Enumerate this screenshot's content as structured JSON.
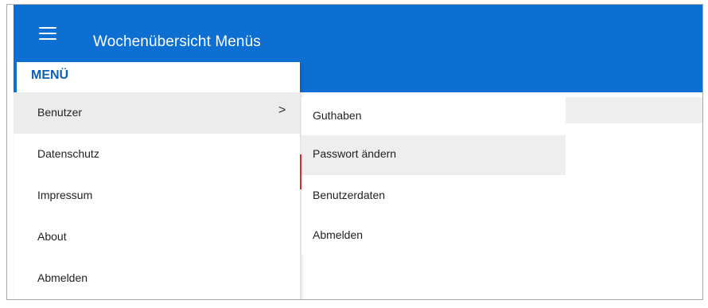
{
  "app": {
    "title": "Wochenübersicht Menüs"
  },
  "menu": {
    "header": "MENÜ",
    "items": [
      {
        "label": "Benutzer",
        "has_submenu": true,
        "chevron": ">"
      },
      {
        "label": "Datenschutz"
      },
      {
        "label": "Impressum"
      },
      {
        "label": "About"
      },
      {
        "label": "Abmelden"
      }
    ]
  },
  "submenu": {
    "items": [
      {
        "label": "Guthaben"
      },
      {
        "label": "Passwort ändern"
      },
      {
        "label": "Benutzerdaten"
      },
      {
        "label": "Abmelden"
      }
    ]
  },
  "colors": {
    "app_bar": "#0d6fd1",
    "menu_header_text": "#0d5fb8",
    "active_row": "#ececec",
    "marker": "#e53935"
  },
  "icons": {
    "menu_toggle": "hamburger-icon",
    "submenu_indicator": "chevron-right-icon"
  }
}
